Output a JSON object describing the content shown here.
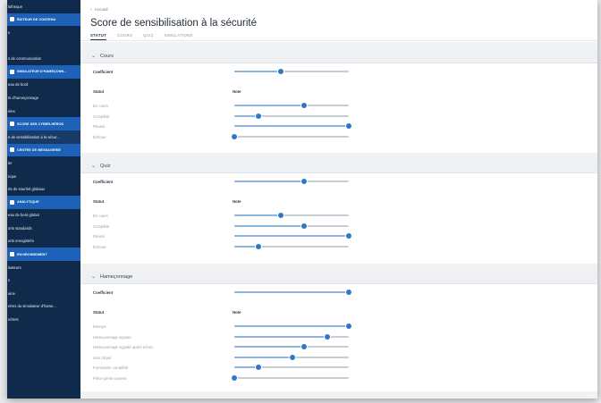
{
  "sidebar": {
    "items": [
      {
        "label": "lotheque",
        "type": "item"
      },
      {
        "label": "ÉDITEUR DE CONTENU",
        "type": "head"
      },
      {
        "label": "s",
        "type": "item"
      },
      {
        "label": "",
        "type": "item"
      },
      {
        "label": "s de communication",
        "type": "item"
      },
      {
        "label": "SIMULATEUR D'HAMEÇONN...",
        "type": "head"
      },
      {
        "label": "eau de bord",
        "type": "item"
      },
      {
        "label": "ts d'hameçonnage",
        "type": "item"
      },
      {
        "label": "eles",
        "type": "item"
      },
      {
        "label": "SCORE DES CYBER-HÉROS",
        "type": "head"
      },
      {
        "label": "e de sensibilisation à la sécur...",
        "type": "item",
        "active": true
      },
      {
        "label": "CENTRE DE MESSAGERIE",
        "type": "head"
      },
      {
        "label": "ier",
        "type": "item"
      },
      {
        "label": "rique",
        "type": "item"
      },
      {
        "label": "rts de sourriel globaux",
        "type": "item"
      },
      {
        "label": "ANALYTIQUE",
        "type": "head"
      },
      {
        "label": "eau de bord global",
        "type": "item"
      },
      {
        "label": "orts standards",
        "type": "item"
      },
      {
        "label": "orts enregistrés",
        "type": "item"
      },
      {
        "label": "ENVIRONNEMENT",
        "type": "head"
      },
      {
        "label": "isateurs",
        "type": "item"
      },
      {
        "label": "s",
        "type": "item"
      },
      {
        "label": "aine",
        "type": "item"
      },
      {
        "label": "etres du simulateur d'hame...",
        "type": "item"
      },
      {
        "label": "nétres",
        "type": "item"
      }
    ]
  },
  "header": {
    "back_label": "Accueil",
    "title": "Score de sensibilisation à la sécurité",
    "tabs": [
      {
        "label": "STATUT",
        "active": true
      },
      {
        "label": "COURS",
        "active": false
      },
      {
        "label": "QUIZ",
        "active": false
      },
      {
        "label": "SIMULATIONS",
        "active": false
      }
    ]
  },
  "sections": [
    {
      "title": "Cours",
      "coefficient_label": "Coefficient",
      "coefficient_value": 0.41,
      "statut_label": "Statut",
      "note_label": "Note",
      "rows": [
        {
          "label": "En cours",
          "value": 0.61
        },
        {
          "label": "Complété",
          "value": 0.21
        },
        {
          "label": "Réussi",
          "value": 1.0
        },
        {
          "label": "Échoué",
          "value": 0.0
        }
      ]
    },
    {
      "title": "Quiz",
      "coefficient_label": "Coefficient",
      "coefficient_value": 0.61,
      "statut_label": "Statut",
      "note_label": "Note",
      "rows": [
        {
          "label": "En cours",
          "value": 0.41
        },
        {
          "label": "Complété",
          "value": 0.61
        },
        {
          "label": "Réussi",
          "value": 1.0
        },
        {
          "label": "Échoué",
          "value": 0.21
        }
      ]
    },
    {
      "title": "Hameçonnage",
      "coefficient_label": "Coefficient",
      "coefficient_value": 1.0,
      "statut_label": "Statut",
      "note_label": "Note",
      "rows": [
        {
          "label": "Envoyé",
          "value": 1.0
        },
        {
          "label": "Hameçonnage signalé",
          "value": 0.81
        },
        {
          "label": "Hameçonnage signalé après échec",
          "value": 0.61
        },
        {
          "label": "Lien cliqué",
          "value": 0.51
        },
        {
          "label": "Formulaire complété",
          "value": 0.21
        },
        {
          "label": "Pièce jointe ouverte",
          "value": 0.0
        }
      ]
    }
  ]
}
